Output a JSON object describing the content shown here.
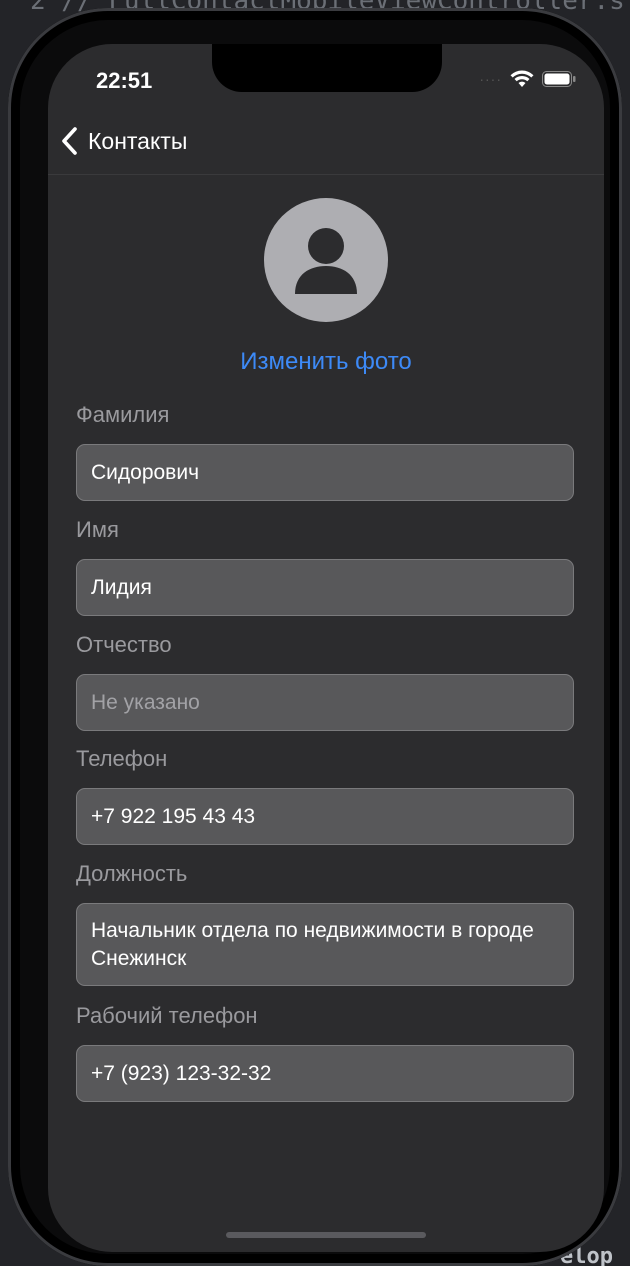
{
  "background": {
    "code_top": "2  //  FullContactMobileViewController.s",
    "code_bottom": "elop"
  },
  "status_bar": {
    "time": "22:51"
  },
  "nav": {
    "back_label": "Контакты"
  },
  "photo": {
    "change_label": "Изменить фото"
  },
  "fields": {
    "last_name": {
      "label": "Фамилия",
      "value": "Сидорович"
    },
    "first_name": {
      "label": "Имя",
      "value": "Лидия"
    },
    "middle_name": {
      "label": "Отчество",
      "value": "",
      "placeholder": "Не указано"
    },
    "phone": {
      "label": "Телефон",
      "value": "+7 922 195 43 43"
    },
    "position": {
      "label": "Должность",
      "value": "Начальник отдела по недвижимости в городе Снежинск"
    },
    "work_phone": {
      "label": "Рабочий телефон",
      "value": "+7 (923) 123-32-32"
    }
  },
  "colors": {
    "accent": "#3d8af7",
    "screen_bg": "#2c2c2e",
    "field_bg": "#58585a",
    "avatar_bg": "#aeaeb2"
  },
  "icons": {
    "back": "chevron-left-icon",
    "avatar": "person-icon",
    "wifi": "wifi-icon",
    "battery": "battery-icon"
  }
}
